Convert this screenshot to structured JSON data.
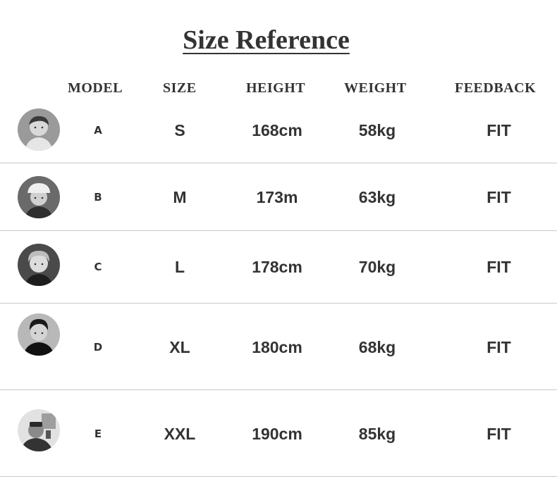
{
  "title": "Size Reference",
  "headers": {
    "model": "MODEL",
    "size": "SIZE",
    "height": "HEIGHT",
    "weight": "WEIGHT",
    "feedback": "FEEDBACK"
  },
  "rows": [
    {
      "avatar": "male-model-portrait",
      "model": "A",
      "size": "S",
      "height": "168cm",
      "weight": "58kg",
      "feedback": "FIT"
    },
    {
      "avatar": "male-model-cap-portrait",
      "model": "B",
      "size": "M",
      "height": "173m",
      "weight": "63kg",
      "feedback": "FIT"
    },
    {
      "avatar": "male-model-portrait",
      "model": "C",
      "size": "L",
      "height": "178cm",
      "weight": "70kg",
      "feedback": "FIT"
    },
    {
      "avatar": "male-model-portrait",
      "model": "D",
      "size": "XL",
      "height": "180cm",
      "weight": "68kg",
      "feedback": "FIT"
    },
    {
      "avatar": "male-model-selfie-portrait",
      "model": "E",
      "size": "XXL",
      "height": "190cm",
      "weight": "85kg",
      "feedback": "FIT"
    }
  ],
  "colors": {
    "text": "#333333",
    "divider": "#c8c8c8",
    "background": "#ffffff"
  }
}
